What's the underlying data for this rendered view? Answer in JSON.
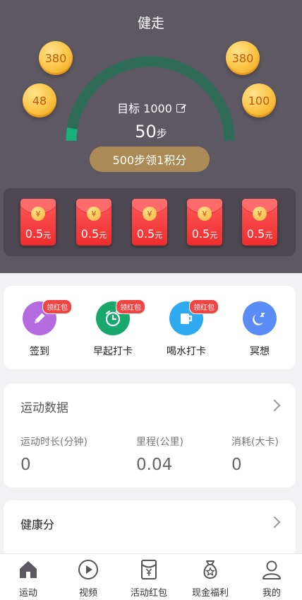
{
  "header": {
    "title": "健走"
  },
  "coins": {
    "left_top": "380",
    "left_bottom": "48",
    "right_top": "380",
    "right_bottom": "100"
  },
  "progress": {
    "goal_label": "目标 1000",
    "steps_value": "50",
    "steps_unit": "步",
    "fraction": 0.05,
    "claim_button": "500步领1积分"
  },
  "envelopes": [
    {
      "value": "0.5",
      "unit": "元",
      "seal": "¥"
    },
    {
      "value": "0.5",
      "unit": "元",
      "seal": "¥"
    },
    {
      "value": "0.5",
      "unit": "元",
      "seal": "¥"
    },
    {
      "value": "0.5",
      "unit": "元",
      "seal": "¥"
    },
    {
      "value": "0.5",
      "unit": "元",
      "seal": "¥"
    }
  ],
  "tasks": [
    {
      "label": "签到",
      "badge": "领红包",
      "icon": "pencil-icon",
      "color": "#b46be0"
    },
    {
      "label": "早起打卡",
      "badge": "领红包",
      "icon": "alarm-clock-icon",
      "color": "#18a86b"
    },
    {
      "label": "喝水打卡",
      "badge": "领红包",
      "icon": "cup-icon",
      "color": "#2eaaf0"
    },
    {
      "label": "冥想",
      "badge": "",
      "icon": "moon-icon",
      "color": "#5a8cf5"
    }
  ],
  "stats": {
    "title": "运动数据",
    "items": [
      {
        "label": "运动时长(分钟)",
        "value": "0"
      },
      {
        "label": "里程(公里)",
        "value": "0.04"
      },
      {
        "label": "消耗(大卡)",
        "value": "0"
      }
    ]
  },
  "health": {
    "title": "健康分"
  },
  "tabbar": [
    {
      "label": "运动",
      "icon": "home-icon"
    },
    {
      "label": "视频",
      "icon": "play-icon"
    },
    {
      "label": "活动红包",
      "icon": "red-envelope-icon"
    },
    {
      "label": "现金福利",
      "icon": "money-bag-icon"
    },
    {
      "label": "我的",
      "icon": "user-icon"
    }
  ],
  "colors": {
    "hero_bg": "#5e5863",
    "gauge_track": "#2f6c58",
    "gauge_fill": "#17b07a",
    "claim_button": "#ac8a55"
  }
}
